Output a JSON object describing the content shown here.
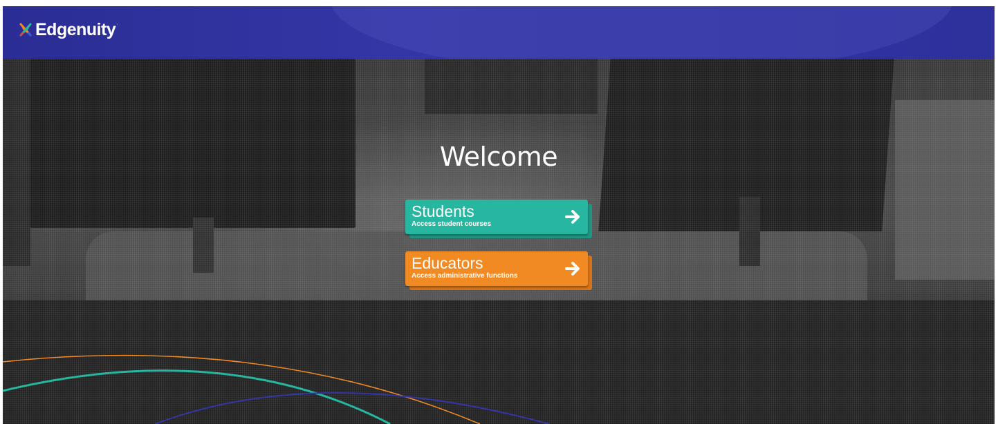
{
  "header": {
    "brand_name": "Edgenuity",
    "brand_trademark": "·",
    "logo_icon": "edgenuity-x-icon",
    "background_color": "#2e309c"
  },
  "main": {
    "welcome_text": "Welcome",
    "options": [
      {
        "title": "Students",
        "subtitle": "Access student courses",
        "arrow_icon": "arrow-right-icon",
        "color": "#27b6a0"
      },
      {
        "title": "Educators",
        "subtitle": "Access administrative functions",
        "arrow_icon": "arrow-right-icon",
        "color": "#f28a24"
      }
    ]
  },
  "decor": {
    "arc_colors": [
      "#f28a24",
      "#27b6a0",
      "#3436a6"
    ]
  }
}
